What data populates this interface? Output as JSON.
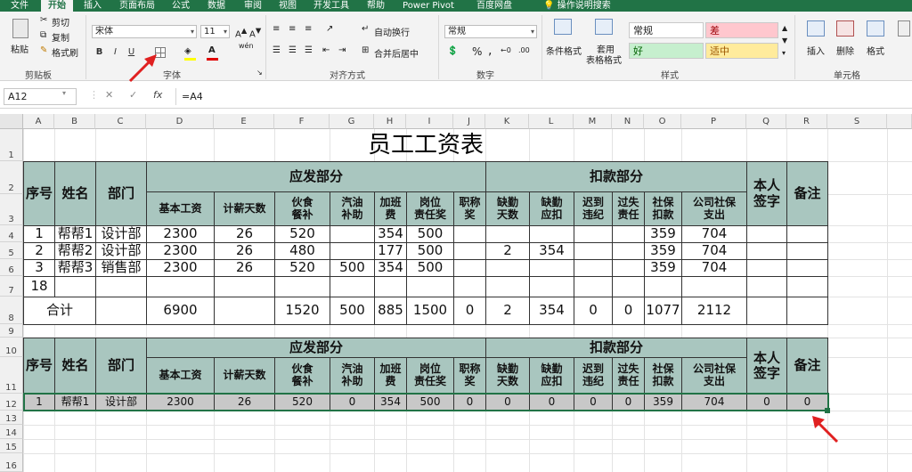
{
  "ribbon_tabs": [
    "文件",
    "开始",
    "插入",
    "页面布局",
    "公式",
    "数据",
    "审阅",
    "视图",
    "开发工具",
    "帮助",
    "Power Pivot",
    "百度网盘",
    "操作说明搜索"
  ],
  "active_tab": "开始",
  "clipboard": {
    "paste": "粘贴",
    "cut": "剪切",
    "copy": "复制",
    "format_painter": "格式刷",
    "label": "剪贴板"
  },
  "font": {
    "name": "宋体",
    "size": "11",
    "bold": "B",
    "italic": "I",
    "underline": "U",
    "label": "字体",
    "phonetic": "wén"
  },
  "alignment": {
    "wrap": "自动换行",
    "merge": "合并后居中",
    "label": "对齐方式"
  },
  "number": {
    "format": "常规",
    "percent": "%",
    "comma": ",",
    "label": "数字"
  },
  "styles": {
    "conditional": "条件格式",
    "table_format_1": "套用",
    "table_format_2": "表格格式",
    "normal": "常规",
    "bad": "差",
    "good": "好",
    "neutral": "适中",
    "label": "样式"
  },
  "cells_group": {
    "insert": "插入",
    "delete": "删除",
    "format": "格式",
    "label": "单元格"
  },
  "formula_bar": {
    "name_box": "A12",
    "formula": "=A4",
    "cancel": "✕",
    "enter": "✓",
    "fx": "fx"
  },
  "columns": [
    "A",
    "B",
    "C",
    "D",
    "E",
    "F",
    "G",
    "H",
    "I",
    "J",
    "K",
    "L",
    "M",
    "N",
    "O",
    "P",
    "Q",
    "R",
    "S"
  ],
  "rows": [
    "1",
    "2",
    "3",
    "4",
    "5",
    "6",
    "7",
    "8",
    "9",
    "10",
    "11",
    "12",
    "13",
    "14",
    "15",
    "16"
  ],
  "sheet": {
    "title": "员工工资表",
    "h_seq": "序号",
    "h_name": "姓名",
    "h_dept": "部门",
    "h_payable": "应发部分",
    "h_deduct": "扣款部分",
    "h_sign": "本人\n签字",
    "h_note": "备注",
    "sub_headers": [
      "基本工资",
      "计薪天数",
      "伙食\n餐补",
      "汽油\n补助",
      "加班\n费",
      "岗位\n责任奖",
      "职称\n奖",
      "缺勤\n天数",
      "缺勤\n应扣",
      "迟到\n违纪",
      "过失\n责任",
      "社保\n扣款",
      "公司社保\n支出"
    ],
    "data_rows": [
      [
        "1",
        "帮帮1",
        "设计部",
        "2300",
        "26",
        "520",
        "",
        "354",
        "500",
        "",
        "",
        "",
        "",
        "",
        "359",
        "704",
        "",
        ""
      ],
      [
        "2",
        "帮帮2",
        "设计部",
        "2300",
        "26",
        "480",
        "",
        "177",
        "500",
        "",
        "2",
        "354",
        "",
        "",
        "359",
        "704",
        "",
        ""
      ],
      [
        "3",
        "帮帮3",
        "销售部",
        "2300",
        "26",
        "520",
        "500",
        "354",
        "500",
        "",
        "",
        "",
        "",
        "",
        "359",
        "704",
        "",
        ""
      ],
      [
        "18",
        "",
        "",
        "",
        "",
        "",
        "",
        "",
        "",
        "",
        "",
        "",
        "",
        "",
        "",
        "",
        "",
        ""
      ]
    ],
    "total_label": "合计",
    "total_row": [
      "",
      "6900",
      "",
      "1520",
      "500",
      "885",
      "1500",
      "0",
      "2",
      "354",
      "0",
      "0",
      "1077",
      "2112",
      "",
      ""
    ],
    "row12": [
      "1",
      "帮帮1",
      "设计部",
      "2300",
      "26",
      "520",
      "0",
      "354",
      "500",
      "0",
      "0",
      "0",
      "0",
      "0",
      "359",
      "704",
      "0",
      "0"
    ]
  }
}
